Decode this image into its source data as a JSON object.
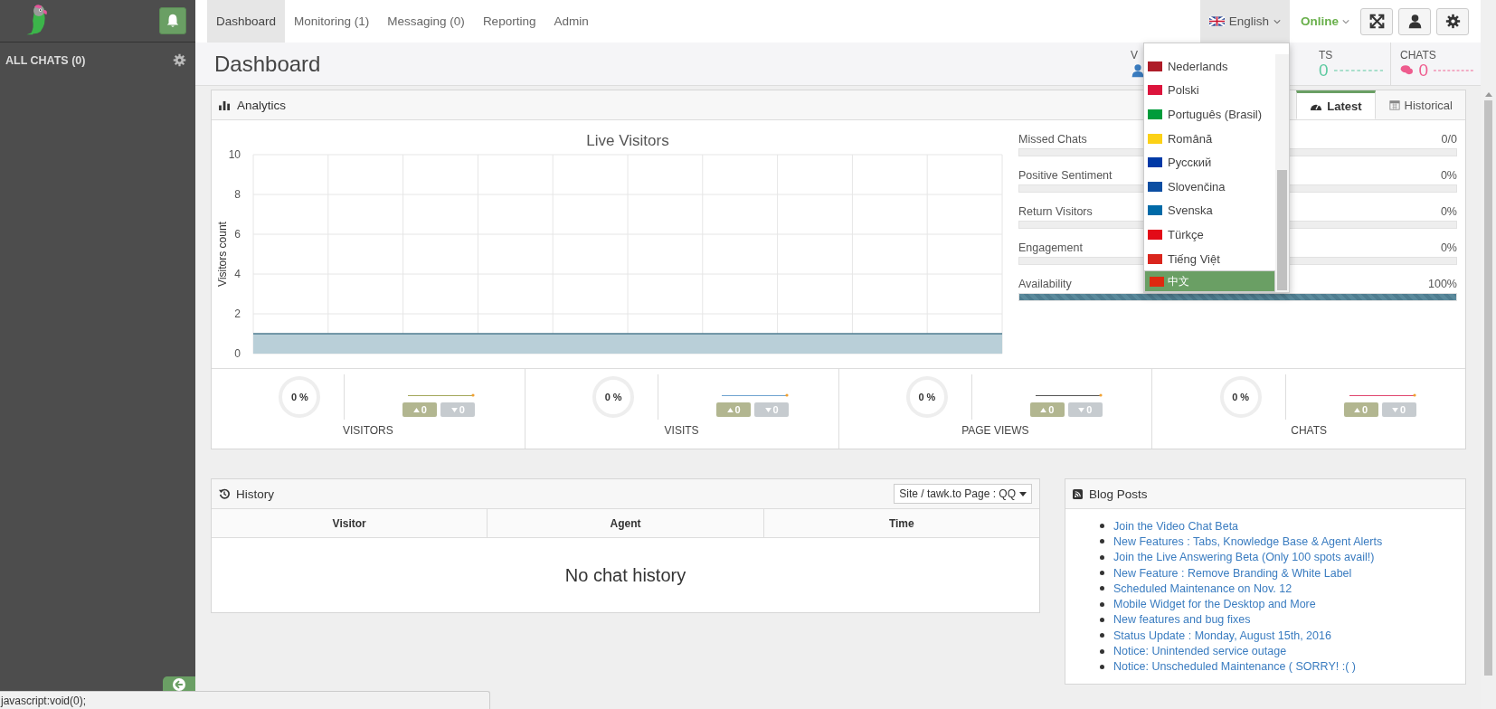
{
  "sidebar": {
    "header": "ALL CHATS (0)"
  },
  "nav": {
    "tabs": [
      {
        "label": "Dashboard",
        "selected": true
      },
      {
        "label": "Monitoring (1)",
        "selected": false
      },
      {
        "label": "Messaging (0)",
        "selected": false
      },
      {
        "label": "Reporting",
        "selected": false
      },
      {
        "label": "Admin",
        "selected": false
      }
    ],
    "language": "English",
    "status": "Online"
  },
  "language_menu": [
    {
      "label": "Nederlands",
      "color": "#ae1c28",
      "selected": false
    },
    {
      "label": "Polski",
      "color": "#dc143c",
      "selected": false
    },
    {
      "label": "Português (Brasil)",
      "color": "#009c3b",
      "selected": false
    },
    {
      "label": "Română",
      "color": "#fcd116",
      "selected": false
    },
    {
      "label": "Русский",
      "color": "#0039a6",
      "selected": false
    },
    {
      "label": "Slovenčina",
      "color": "#0b4ea2",
      "selected": false
    },
    {
      "label": "Svenska",
      "color": "#006aa7",
      "selected": false
    },
    {
      "label": "Türkçe",
      "color": "#e30a17",
      "selected": false
    },
    {
      "label": "Tiếng Việt",
      "color": "#da251d",
      "selected": false
    },
    {
      "label": "中文",
      "color": "#de2910",
      "selected": true
    }
  ],
  "page_title": "Dashboard",
  "header_stats": [
    {
      "label": "V",
      "color": "#3a7cc0"
    },
    {
      "label": "TS",
      "value": "0",
      "color": "#5cc9a0"
    },
    {
      "label": "CHATS",
      "value": "0",
      "color": "#ee5c8e"
    }
  ],
  "analytics": {
    "title": "Analytics",
    "tabs": [
      {
        "label": "Latest",
        "selected": true
      },
      {
        "label": "Historical",
        "selected": false
      }
    ],
    "chart_data": {
      "type": "area",
      "grid": true,
      "title": "Live Visitors",
      "ylabel": "Visitors count",
      "ylim": [
        0,
        10
      ],
      "yticks": [
        0,
        2,
        4,
        6,
        8,
        10
      ],
      "series": [
        {
          "color": "#b9cfd8",
          "values": [
            1,
            1,
            1,
            1,
            1,
            1,
            1,
            1,
            1,
            1,
            1
          ]
        }
      ]
    },
    "metrics": [
      {
        "label": "Missed Chats",
        "reading": "0/0",
        "level": 0
      },
      {
        "label": "Positive Sentiment",
        "reading": "0%",
        "level": 0
      },
      {
        "label": "Return Visitors",
        "reading": "0%",
        "level": 0
      },
      {
        "label": "Engagement",
        "reading": "0%",
        "level": 0
      },
      {
        "label": "Availability",
        "reading": "100%",
        "level": 1
      }
    ],
    "summary": [
      {
        "label": "VISITORS",
        "percent": "0 %",
        "color": "#a3a85a",
        "up": "0",
        "down": "0"
      },
      {
        "label": "VISITS",
        "percent": "0 %",
        "color": "#6fa3d0",
        "up": "0",
        "down": "0"
      },
      {
        "label": "PAGE VIEWS",
        "percent": "0 %",
        "color": "#555555",
        "up": "0",
        "down": "0"
      },
      {
        "label": "CHATS",
        "percent": "0 %",
        "color": "#e0466e",
        "up": "0",
        "down": "0"
      }
    ]
  },
  "history": {
    "title": "History",
    "filter": "Site / tawk.to Page : QQ",
    "columns": [
      "Visitor",
      "Agent",
      "Time"
    ],
    "empty": "No chat history"
  },
  "blog": {
    "title": "Blog Posts",
    "posts": [
      "Join the Video Chat Beta",
      "New Features : Tabs, Knowledge Base & Agent Alerts",
      "Join the Live Answering Beta (Only 100 spots avail!)",
      "New Feature : Remove Branding & White Label",
      "Scheduled Maintenance on Nov. 12",
      "Mobile Widget for the Desktop and More",
      "New features and bug fixes",
      "Status Update : Monday, August 15th, 2016",
      "Notice: Unintended service outage",
      "Notice: Unscheduled Maintenance ( SORRY! :( )"
    ]
  },
  "status_bar": "javascript:void(0);"
}
